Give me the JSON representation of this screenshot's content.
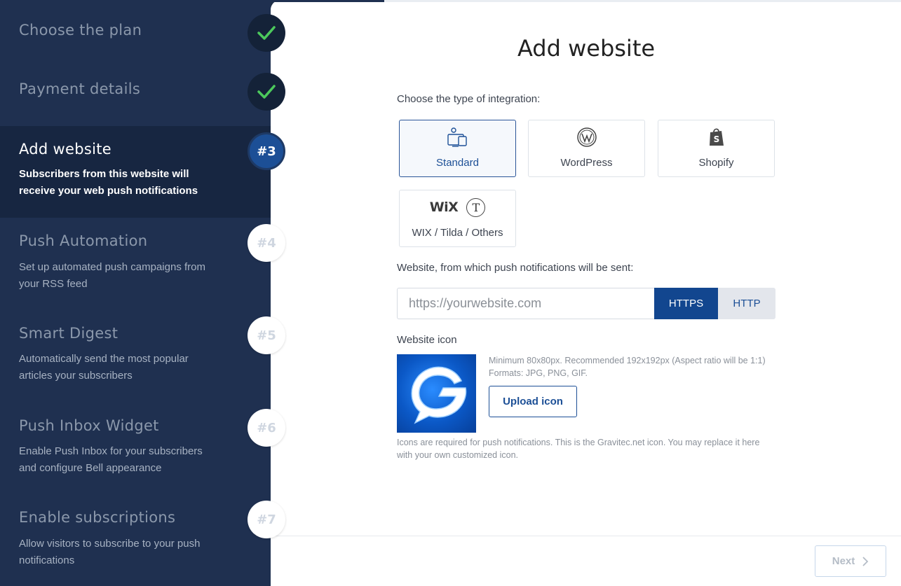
{
  "sidebar": {
    "steps": [
      {
        "title": "Choose the plan",
        "desc": "",
        "badge": "",
        "state": "done"
      },
      {
        "title": "Payment details",
        "desc": "",
        "badge": "",
        "state": "done"
      },
      {
        "title": "Add website",
        "desc": "Subscribers from this website will receive your web push notifications",
        "badge": "#3",
        "state": "current"
      },
      {
        "title": "Push Automation",
        "desc": "Set up automated push campaigns from your RSS feed",
        "badge": "#4",
        "state": "todo"
      },
      {
        "title": "Smart Digest",
        "desc": "Automatically send the most popular articles your subscribers",
        "badge": "#5",
        "state": "todo"
      },
      {
        "title": "Push Inbox Widget",
        "desc": "Enable Push Inbox for your subscribers and configure Bell appearance",
        "badge": "#6",
        "state": "todo"
      },
      {
        "title": "Enable subscriptions",
        "desc": "Allow visitors to subscribe to your push notifications",
        "badge": "#7",
        "state": "todo"
      }
    ]
  },
  "main": {
    "title": "Add website",
    "integration_label": "Choose the type of integration:",
    "integrations": [
      {
        "name": "Standard",
        "icon": "desktop-mobile-icon",
        "selected": true
      },
      {
        "name": "WordPress",
        "icon": "wordpress-icon",
        "selected": false
      },
      {
        "name": "Shopify",
        "icon": "shopify-icon",
        "selected": false
      },
      {
        "name": "WIX / Tilda / Others",
        "icon": "wix-tilda-icon",
        "logo_text": "WiX",
        "tilda_text": "T",
        "selected": false
      }
    ],
    "website_label": "Website, from which push notifications will be sent:",
    "website_placeholder": "https://yourwebsite.com",
    "protocols": [
      "HTTPS",
      "HTTP"
    ],
    "selected_protocol": "HTTPS",
    "icon_label": "Website icon",
    "icon_hint": "Minimum 80x80px. Recommended 192x192px (Aspect ratio will be 1:1) Formats: JPG, PNG, GIF.",
    "upload_label": "Upload icon",
    "icon_note": "Icons are required for push notifications. This is the Gravitec.net icon. You may replace it here with your own customized icon.",
    "next_label": "Next"
  },
  "colors": {
    "sidebar_bg": "#1f3050",
    "active_step_bg": "#172641",
    "accent": "#1c4f96",
    "check_green": "#4cc95c"
  }
}
